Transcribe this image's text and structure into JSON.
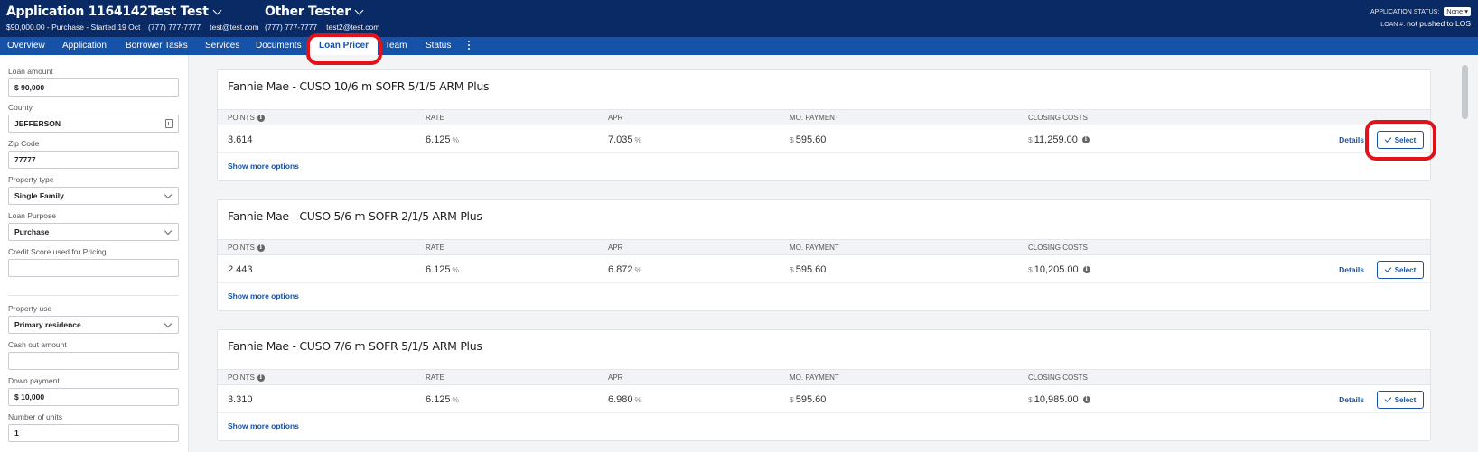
{
  "header": {
    "application": {
      "title": "Application 1164142",
      "subtitle": "$90,000.00 - Purchase - Started 19 Oct"
    },
    "borrower": {
      "name": "Test Test",
      "phone": "(777) 777-7777",
      "email": "test@test.com"
    },
    "coborrower": {
      "name": "Other Tester",
      "phone": "(777) 777-7777",
      "email": "test2@test.com"
    },
    "status_label": "APPLICATION STATUS:",
    "status_value": "None",
    "loan_label": "LOAN #:",
    "loan_value": "not pushed to LOS"
  },
  "nav": {
    "tabs": [
      {
        "label": "Overview"
      },
      {
        "label": "Application"
      },
      {
        "label": "Borrower Tasks"
      },
      {
        "label": "Services"
      },
      {
        "label": "Documents"
      },
      {
        "label": "Loan Pricer",
        "active": true
      },
      {
        "label": "Team"
      },
      {
        "label": "Status"
      }
    ]
  },
  "sidebar": {
    "fields": [
      {
        "label": "Loan amount",
        "value": "$ 90,000",
        "type": "input"
      },
      {
        "label": "County",
        "value": "JEFFERSON",
        "type": "picker"
      },
      {
        "label": "Zip Code",
        "value": "77777",
        "type": "input"
      },
      {
        "label": "Property type",
        "value": "Single Family",
        "type": "select"
      },
      {
        "label": "Loan Purpose",
        "value": "Purchase",
        "type": "select"
      },
      {
        "label": "Credit Score used for Pricing",
        "value": "",
        "type": "input"
      },
      {
        "label": "Property use",
        "value": "Primary residence",
        "type": "select"
      },
      {
        "label": "Cash out amount",
        "value": "",
        "type": "input"
      },
      {
        "label": "Down payment",
        "value": "$ 10,000",
        "type": "input"
      },
      {
        "label": "Number of units",
        "value": "1",
        "type": "input"
      }
    ]
  },
  "columns": {
    "points": "POINTS",
    "rate": "RATE",
    "apr": "APR",
    "payment": "MO. PAYMENT",
    "closing": "CLOSING COSTS"
  },
  "units": {
    "percent": "%",
    "dollar": "$"
  },
  "actions": {
    "details": "Details",
    "select": "Select",
    "more": "Show more options"
  },
  "products": [
    {
      "title": "Fannie Mae - CUSO 10/6 m SOFR 5/1/5 ARM Plus",
      "points": "3.614",
      "rate": "6.125",
      "apr": "7.035",
      "payment": "595.60",
      "closing": "11,259.00"
    },
    {
      "title": "Fannie Mae - CUSO 5/6 m SOFR 2/1/5 ARM Plus",
      "points": "2.443",
      "rate": "6.125",
      "apr": "6.872",
      "payment": "595.60",
      "closing": "10,205.00"
    },
    {
      "title": "Fannie Mae - CUSO 7/6 m SOFR 5/1/5 ARM Plus",
      "points": "3.310",
      "rate": "6.125",
      "apr": "6.980",
      "payment": "595.60",
      "closing": "10,985.00"
    }
  ],
  "icons": {
    "info": "info-icon",
    "check": "check-icon",
    "chevron": "chevron-down-icon",
    "kebab": "kebab-menu-icon"
  },
  "colors": {
    "header": "#0a2a66",
    "nav": "#1552a8",
    "highlight": "#e0121a"
  }
}
